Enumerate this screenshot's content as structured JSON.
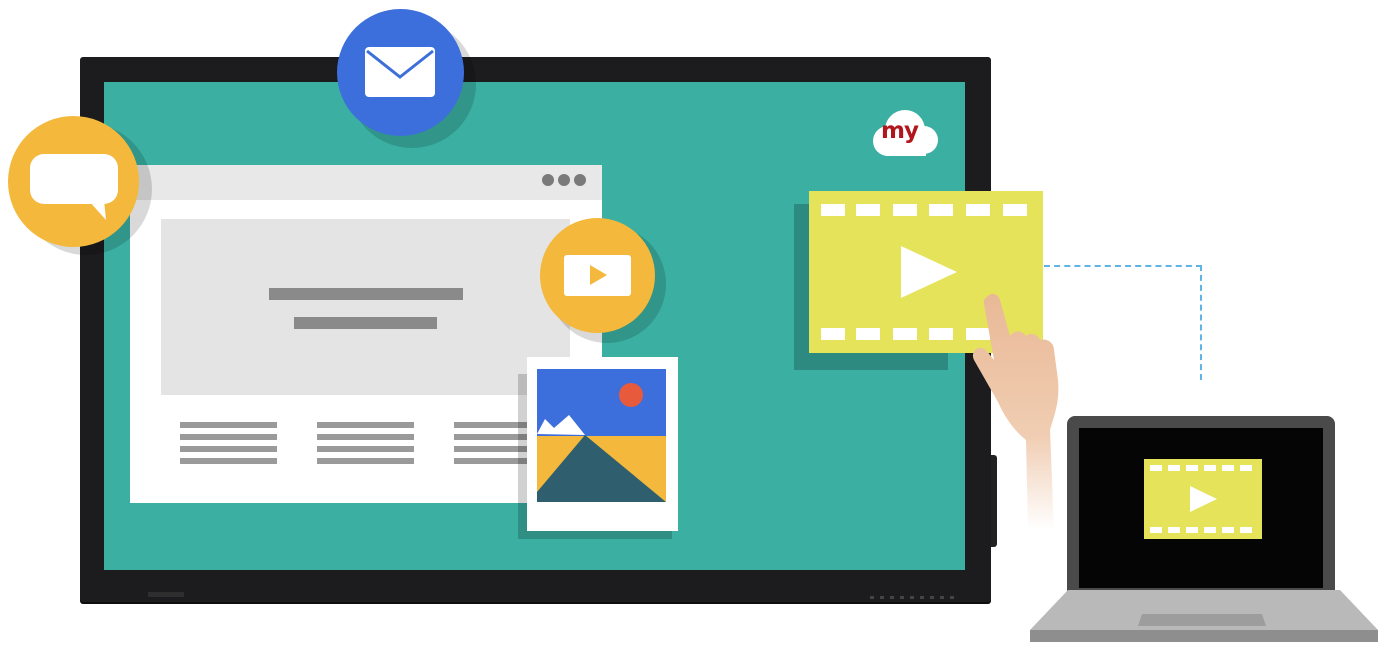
{
  "brand": {
    "logo_text": "my"
  },
  "icons": {
    "chat": "chat-bubble-icon",
    "mail": "envelope-icon",
    "video": "play-icon",
    "photo": "landscape-image-icon",
    "film": "film-strip-play-icon",
    "browser": "browser-window-icon",
    "laptop": "laptop-icon",
    "hand": "pointing-hand-icon",
    "cloud": "cloud-icon"
  },
  "colors": {
    "screen": "#3aafa2",
    "accent_yellow": "#f3b83c",
    "accent_blue": "#3d6fdc",
    "film_yellow": "#e5e35a",
    "brand_red": "#b0161c",
    "dashed_line": "#5fb3e6"
  }
}
